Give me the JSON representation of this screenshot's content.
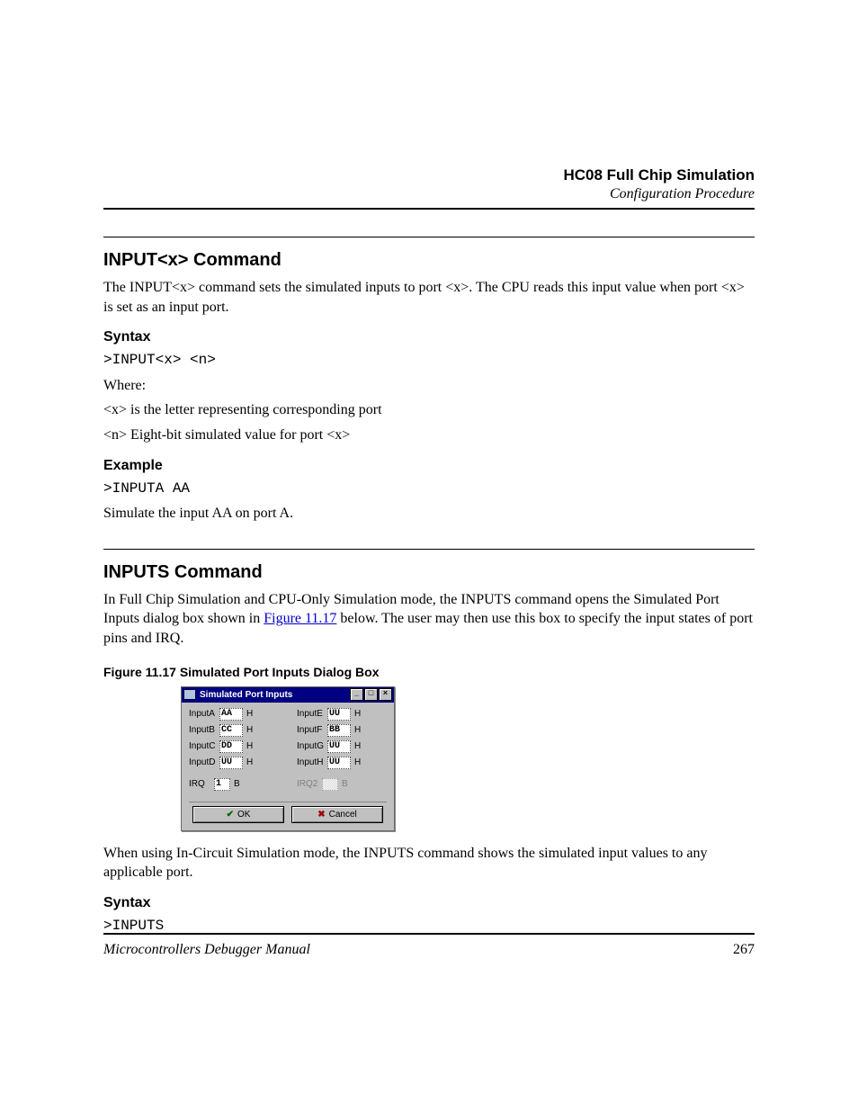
{
  "running_head": {
    "title": "HC08 Full Chip Simulation",
    "subtitle": "Configuration Procedure"
  },
  "sections": {
    "inputx": {
      "title": "INPUT<x> Command",
      "intro": "The INPUT<x> command sets the simulated inputs to port <x>. The CPU reads this input value when port <x> is set as an input port.",
      "syntax_label": "Syntax",
      "syntax_line": ">INPUT<x>  <n>",
      "syntax_where": "Where:",
      "syntax_desc1": "<x> is the letter representing corresponding port",
      "syntax_desc2": "<n> Eight-bit simulated value for port <x>",
      "example_label": "Example",
      "example_line": ">INPUTA AA",
      "example_desc": "Simulate the input AA on port A."
    },
    "inputs": {
      "title": "INPUTS Command",
      "intro_pre": "In Full Chip Simulation and CPU-Only Simulation mode, the INPUTS command opens the Simulated Port Inputs dialog box shown in ",
      "intro_link": "Figure 11.17",
      "intro_post": " below. The user may then use this box to specify the input states of port pins and IRQ.",
      "figure_caption": "Figure 11.17   Simulated Port Inputs Dialog Box",
      "after_fig": "When using In-Circuit Simulation mode, the INPUTS command shows the simulated input values to any applicable port.",
      "syntax_label": "Syntax",
      "syntax_line": ">INPUTS"
    }
  },
  "dialog": {
    "title": "Simulated Port Inputs",
    "left": [
      {
        "lbl": "InputA",
        "val": "AA",
        "sfx": "H"
      },
      {
        "lbl": "InputB",
        "val": "CC",
        "sfx": "H"
      },
      {
        "lbl": "InputC",
        "val": "DD",
        "sfx": "H"
      },
      {
        "lbl": "InputD",
        "val": "UU",
        "sfx": "H"
      }
    ],
    "right": [
      {
        "lbl": "InputE",
        "val": "UU",
        "sfx": "H"
      },
      {
        "lbl": "InputF",
        "val": "BB",
        "sfx": "H"
      },
      {
        "lbl": "InputG",
        "val": "UU",
        "sfx": "H"
      },
      {
        "lbl": "InputH",
        "val": "UU",
        "sfx": "H"
      }
    ],
    "irq": {
      "lbl": "IRQ",
      "val": "1",
      "sfx": "B"
    },
    "irq2": {
      "lbl": "IRQ2",
      "val": "",
      "sfx": "B"
    },
    "ok": "OK",
    "cancel": "Cancel"
  },
  "footer": {
    "left": "Microcontrollers Debugger Manual",
    "right": "267"
  }
}
